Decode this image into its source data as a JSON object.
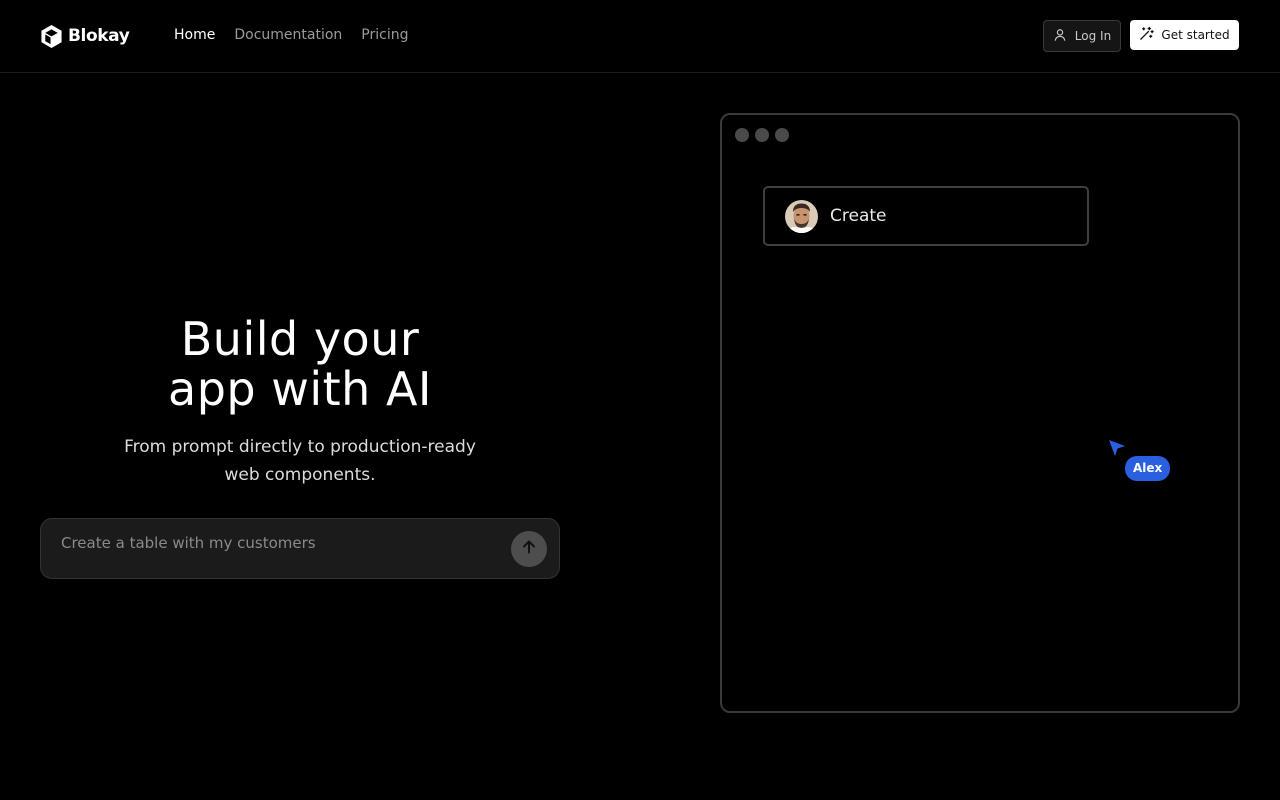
{
  "brand": {
    "name": "Blokay"
  },
  "nav": {
    "links": [
      {
        "label": "Home",
        "active": true
      },
      {
        "label": "Documentation",
        "active": false
      },
      {
        "label": "Pricing",
        "active": false
      }
    ],
    "login_label": "Log In",
    "cta_label": "Get started"
  },
  "hero": {
    "title_line1": "Build your",
    "title_line2": "app with AI",
    "subtitle_line1": "From prompt directly to production-ready",
    "subtitle_line2": "web components.",
    "prompt_placeholder": "Create a table with my customers"
  },
  "preview": {
    "create_label": "Create",
    "cursor_user": "Alex"
  },
  "colors": {
    "background": "#000000",
    "cursor_accent": "#2a5fe0",
    "cta_background": "#ffffff"
  },
  "icons": {
    "logo": "hexagon-cube-logo-icon",
    "login": "user-icon",
    "cta": "magic-wand-icon",
    "send": "arrow-up-icon",
    "cursor": "pointer-cursor-icon"
  }
}
